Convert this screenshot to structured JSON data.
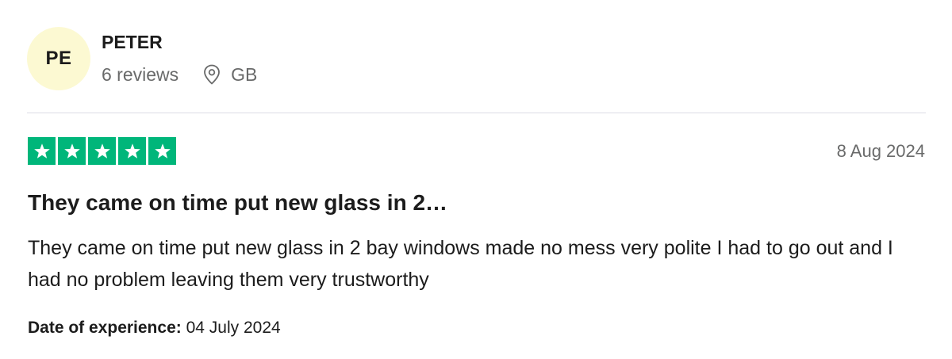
{
  "user": {
    "initials": "PE",
    "name": "PETER",
    "reviews_count": "6 reviews",
    "location_icon": "location-pin-icon",
    "country": "GB"
  },
  "review": {
    "rating": 5,
    "rating_max": 5,
    "star_color": "#00b67a",
    "date": "8 Aug 2024",
    "title": "They came on time put new glass in 2…",
    "body": "They came on time put new glass in 2 bay windows made no mess very polite I had to go out and I had no problem leaving them very trustworthy",
    "experience_label": "Date of experience:",
    "experience_date": "04 July 2024"
  },
  "colors": {
    "avatar_bg": "#fcf9d2",
    "text_primary": "#1c1c1c",
    "text_secondary": "#696a6a",
    "divider": "#dcdce6"
  }
}
